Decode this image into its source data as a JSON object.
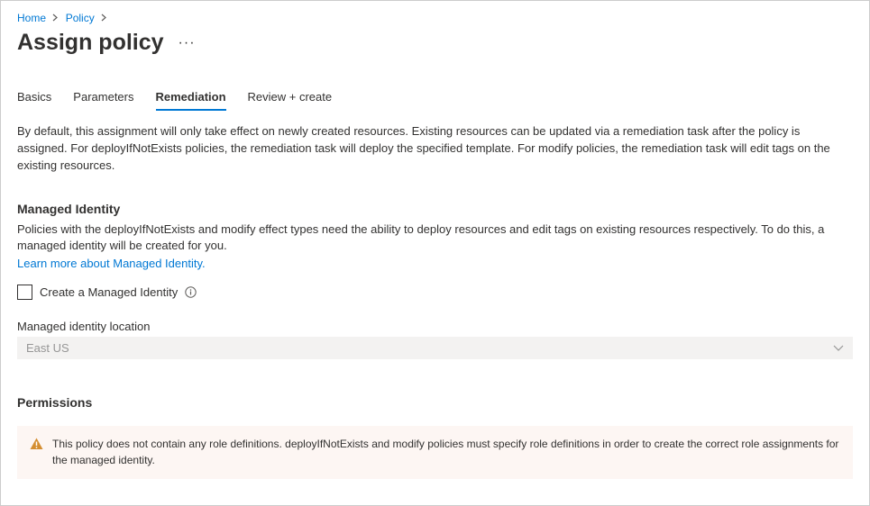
{
  "breadcrumb": {
    "home": "Home",
    "policy": "Policy"
  },
  "page": {
    "title": "Assign policy"
  },
  "tabs": {
    "basics": "Basics",
    "parameters": "Parameters",
    "remediation": "Remediation",
    "review": "Review + create"
  },
  "remediation": {
    "description": "By default, this assignment will only take effect on newly created resources. Existing resources can be updated via a remediation task after the policy is assigned. For deployIfNotExists policies, the remediation task will deploy the specified template. For modify policies, the remediation task will edit tags on the existing resources."
  },
  "managedIdentity": {
    "heading": "Managed Identity",
    "text": "Policies with the deployIfNotExists and modify effect types need the ability to deploy resources and edit tags on existing resources respectively. To do this, a managed identity will be created for you.",
    "learnMore": "Learn more about Managed Identity.",
    "checkboxLabel": "Create a Managed Identity",
    "locationLabel": "Managed identity location",
    "locationValue": "East US"
  },
  "permissions": {
    "heading": "Permissions",
    "warning": "This policy does not contain any role definitions. deployIfNotExists and modify policies must specify role definitions in order to create the correct role assignments for the managed identity."
  }
}
